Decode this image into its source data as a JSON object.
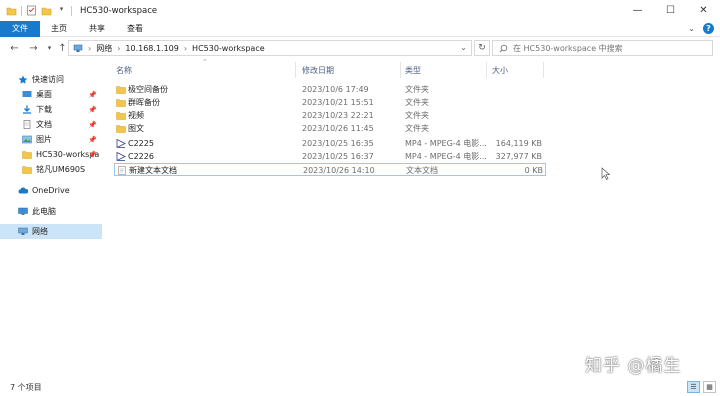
{
  "window": {
    "title": "HC530-workspace"
  },
  "ribbon": {
    "tabs": [
      "文件",
      "主页",
      "共享",
      "查看"
    ]
  },
  "address": {
    "segments": [
      "网络",
      "10.168.1.109",
      "HC530-workspace"
    ]
  },
  "search": {
    "placeholder": "在 HC530-workspace 中搜索"
  },
  "nav": {
    "quick_access": "快速访问",
    "items": [
      "桌面",
      "下载",
      "文档",
      "图片",
      "HC530-workspa",
      "铭凡UM690S"
    ],
    "onedrive": "OneDrive",
    "this_pc": "此电脑",
    "network": "网络"
  },
  "columns": {
    "name": "名称",
    "date": "修改日期",
    "type": "类型",
    "size": "大小"
  },
  "files": [
    {
      "name": "极空间备份",
      "date": "2023/10/6 17:49",
      "type": "文件夹",
      "size": "",
      "icon": "folder-icon"
    },
    {
      "name": "群晖备份",
      "date": "2023/10/21 15:51",
      "type": "文件夹",
      "size": "",
      "icon": "folder-icon"
    },
    {
      "name": "视频",
      "date": "2023/10/23 22:21",
      "type": "文件夹",
      "size": "",
      "icon": "folder-icon"
    },
    {
      "name": "图文",
      "date": "2023/10/26 11:45",
      "type": "文件夹",
      "size": "",
      "icon": "folder-icon"
    },
    {
      "name": "C2225",
      "date": "2023/10/25 16:35",
      "type": "MP4 - MPEG-4 电影...",
      "size": "164,119 KB",
      "icon": "video-file-icon"
    },
    {
      "name": "C2226",
      "date": "2023/10/25 16:37",
      "type": "MP4 - MPEG-4 电影...",
      "size": "327,977 KB",
      "icon": "video-file-icon"
    },
    {
      "name": "新建文本文档",
      "date": "2023/10/26 14:10",
      "type": "文本文档",
      "size": "0 KB",
      "icon": "text-file-icon"
    }
  ],
  "status": {
    "item_count": "7 个项目"
  },
  "watermark": "知乎 @橘生",
  "colors": {
    "accent": "#1979ca",
    "selection": "#cce4f7",
    "folder": "#f3c54a"
  }
}
